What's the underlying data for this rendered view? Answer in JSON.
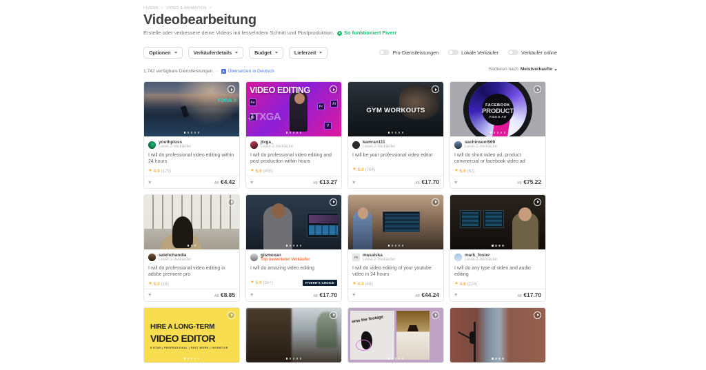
{
  "breadcrumb": {
    "items": [
      "FIVERR",
      "VIDEO & ANIMATION"
    ],
    "separator": ">"
  },
  "header": {
    "title": "Videobearbeitung",
    "subtitle": "Erstelle oder verbessere deine Videos mit fesselndem Schnitt und Postproduktion.",
    "how_it_works": "So funktioniert Fiverr"
  },
  "filters": {
    "pills": [
      {
        "label": "Optionen"
      },
      {
        "label": "Verkäuferdetails"
      },
      {
        "label": "Budget"
      },
      {
        "label": "Lieferzeit"
      }
    ],
    "toggles": [
      {
        "label": "Pro-Dienstleistungen",
        "on": false
      },
      {
        "label": "Lokale Verkäufer",
        "on": false
      },
      {
        "label": "Verkäufer online",
        "on": false
      }
    ]
  },
  "results": {
    "count_text": "1,742 verfügbare Dienstleistungen",
    "separator": "-",
    "translate_label": "Übersetzen in Deutsch",
    "translate_icon": "translate-icon",
    "sort_prefix": "Sortieren nach",
    "sort_value": "Meistverkaufte"
  },
  "labels": {
    "price_prefix": "AB",
    "favorite_icon": "heart-icon",
    "play_icon": "play-icon"
  },
  "badges": {
    "fiverrs_choice": "FIVERR'S CHOICE"
  },
  "gigs": [
    {
      "seller": "youthpluss",
      "level": "Level-2-Verkäufer",
      "level_type": "normal",
      "title": "I will do professional video editing within 24 hours",
      "rating": "4.9",
      "reviews": "(175)",
      "price": "€4.42",
      "thumb_style": "art-capetown",
      "thumb_text": "YOGA.Ii",
      "dots": 5,
      "active_dot": 0,
      "badge": null
    },
    {
      "seller": "jtxga_",
      "level": "Level-1-Verkäufer",
      "level_type": "normal",
      "title": "I will do professional video editing and post production within hours",
      "rating": "5.0",
      "reviews": "(455)",
      "price": "€13.27",
      "thumb_style": "art-ve",
      "thumb_text": "VIDEO EDITING",
      "thumb_text2": "JTXGA",
      "dots": 5,
      "active_dot": 0,
      "badge": null
    },
    {
      "seller": "kamran111",
      "level": "Level-2-Verkäufer",
      "level_type": "normal",
      "title": "I will be your professional video editor",
      "rating": "5.0",
      "reviews": "(764)",
      "price": "€17.70",
      "thumb_style": "art-gym",
      "thumb_text": "GYM WORKOUTS",
      "dots": 5,
      "active_dot": 0,
      "badge": null
    },
    {
      "seller": "sachinsoni569",
      "level": "Level-2-Verkäufer",
      "level_type": "normal",
      "title": "I will do short video ad, product commercial or facebook video ad",
      "rating": "5.0",
      "reviews": "(62)",
      "price": "€75.22",
      "thumb_style": "art-fb",
      "thumb_text": "FACEBOOK",
      "thumb_text2": "PRODUCT",
      "thumb_text3": "VIDEO AD",
      "dots": 5,
      "active_dot": 0,
      "badge": null
    },
    {
      "seller": "salehchandia",
      "level": "Level-1-Verkäufer",
      "level_type": "normal",
      "title": "I will do professional video editing in adobe premiere pro",
      "rating": "5.0",
      "reviews": "(18)",
      "price": "€8.85",
      "thumb_style": "art-office",
      "dots": 3,
      "active_dot": 0,
      "badge": null
    },
    {
      "seller": "gismoxan",
      "level": "Top bewerteter Verkäufer",
      "level_type": "top",
      "title": "I will do amazing video editing",
      "rating": "5.0",
      "reviews": "(1k+)",
      "price": "€17.70",
      "thumb_style": "art-editor",
      "dots": 5,
      "active_dot": 0,
      "badge": "FIVERR'S CHOICE"
    },
    {
      "seller": "masalska",
      "level": "Level-2-Verkäufer",
      "level_type": "normal",
      "title": "I will do video editing of your youtube video in 24 hours",
      "rating": "4.9",
      "reviews": "(48)",
      "price": "€44.24",
      "thumb_style": "art-studio",
      "dots": 5,
      "active_dot": 0,
      "badge": null,
      "avatar_initial": "m"
    },
    {
      "seller": "mark_foster",
      "level": "Level-2-Verkäufer",
      "level_type": "normal",
      "title": "I will do any type of video and audio editing",
      "rating": "4.8",
      "reviews": "(224)",
      "price": "€17.70",
      "thumb_style": "art-desk",
      "dots": 4,
      "active_dot": 0,
      "badge": null
    },
    {
      "seller": "",
      "level": "",
      "level_type": "normal",
      "title": "",
      "rating": "",
      "reviews": "",
      "price": "",
      "thumb_style": "art-yellow",
      "thumb_text": "HIRE A LONG-TERM",
      "thumb_text2": "VIDEO EDITOR",
      "thumb_text3": "5 STAR | PROFESSIONAL | FAST WORK | INVENTIVE",
      "dots": 5,
      "active_dot": 0,
      "badge": null
    },
    {
      "seller": "",
      "level": "",
      "level_type": "normal",
      "title": "",
      "rating": "",
      "reviews": "",
      "price": "",
      "thumb_style": "art-road",
      "dots": 5,
      "active_dot": 0,
      "badge": null
    },
    {
      "seller": "",
      "level": "",
      "level_type": "normal",
      "title": "",
      "rating": "",
      "reviews": "",
      "price": "",
      "thumb_style": "art-collage",
      "thumb_text": "ome the footage",
      "dots": 5,
      "active_dot": 0,
      "badge": null
    },
    {
      "seller": "",
      "level": "",
      "level_type": "normal",
      "title": "",
      "rating": "",
      "reviews": "",
      "price": "",
      "thumb_style": "art-door",
      "dots": 4,
      "active_dot": 0,
      "badge": null
    }
  ],
  "colors": {
    "brand_green": "#1dbf73",
    "star": "#ffb33e",
    "top_seller": "#ff7640",
    "link_blue": "#4a73e8",
    "badge_navy": "#081f33",
    "text": "#404145",
    "muted": "#74767e"
  }
}
